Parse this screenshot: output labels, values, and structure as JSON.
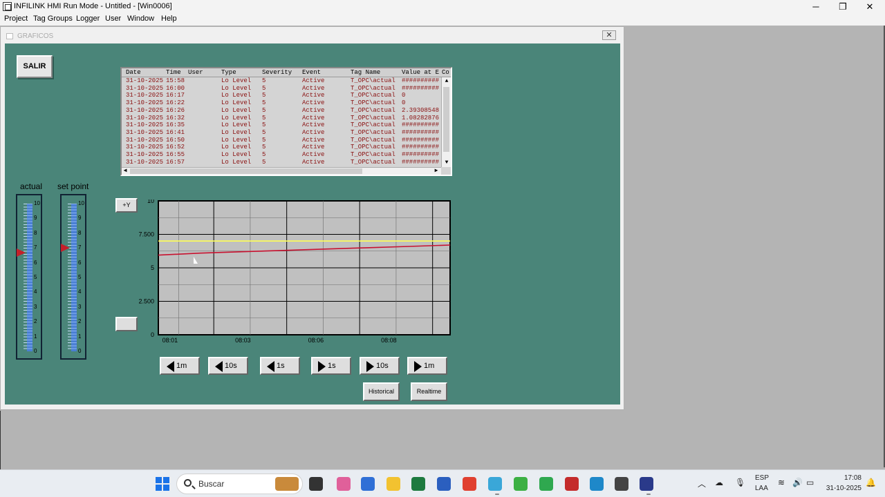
{
  "app": {
    "title": "INFILINK HMI Run Mode - Untitled - [Win0006]",
    "minimize_glyph": "─",
    "restore_glyph": "❐",
    "close_glyph": "✕"
  },
  "menu": [
    "Project",
    "Tag Groups",
    "Logger",
    "User",
    "Window",
    "Help"
  ],
  "child_window": {
    "title": "GRAFICOS",
    "close_glyph": "✕"
  },
  "salir_label": "SALIR",
  "alarm_table": {
    "headers": [
      "Date",
      "Time",
      "User",
      "Type",
      "Severity",
      "Event",
      "Tag Name",
      "Value at E",
      "Co"
    ],
    "rows": [
      [
        "31-10-2025",
        "15:58",
        "",
        "Lo Level",
        "5",
        "Active",
        "T_OPC\\actual",
        "##########"
      ],
      [
        "31-10-2025",
        "16:00",
        "",
        "Lo Level",
        "5",
        "Active",
        "T_OPC\\actual",
        "##########"
      ],
      [
        "31-10-2025",
        "16:17",
        "",
        "Lo Level",
        "5",
        "Active",
        "T_OPC\\actual",
        "0"
      ],
      [
        "31-10-2025",
        "16:22",
        "",
        "Lo Level",
        "5",
        "Active",
        "T_OPC\\actual",
        "0"
      ],
      [
        "31-10-2025",
        "16:26",
        "",
        "Lo Level",
        "5",
        "Active",
        "T_OPC\\actual",
        "2.39308548"
      ],
      [
        "31-10-2025",
        "16:32",
        "",
        "Lo Level",
        "5",
        "Active",
        "T_OPC\\actual",
        "1.08282876"
      ],
      [
        "31-10-2025",
        "16:35",
        "",
        "Lo Level",
        "5",
        "Active",
        "T_OPC\\actual",
        "##########"
      ],
      [
        "31-10-2025",
        "16:41",
        "",
        "Lo Level",
        "5",
        "Active",
        "T_OPC\\actual",
        "##########"
      ],
      [
        "31-10-2025",
        "16:50",
        "",
        "Lo Level",
        "5",
        "Active",
        "T_OPC\\actual",
        "##########"
      ],
      [
        "31-10-2025",
        "16:52",
        "",
        "Lo Level",
        "5",
        "Active",
        "T_OPC\\actual",
        "##########"
      ],
      [
        "31-10-2025",
        "16:55",
        "",
        "Lo Level",
        "5",
        "Active",
        "T_OPC\\actual",
        "##########"
      ],
      [
        "31-10-2025",
        "16:57",
        "",
        "Lo Level",
        "5",
        "Active",
        "T_OPC\\actual",
        "##########"
      ]
    ]
  },
  "gauges": {
    "actual": {
      "label": "actual",
      "value": 6.7,
      "scale": [
        "10",
        "9",
        "8",
        "7",
        "6",
        "5",
        "4",
        "3",
        "2",
        "1",
        "0"
      ]
    },
    "setpoint": {
      "label": "set point",
      "value": 7.0,
      "scale": [
        "10",
        "9",
        "8",
        "7",
        "6",
        "5",
        "4",
        "3",
        "2",
        "1",
        "0"
      ]
    }
  },
  "buttons": {
    "plus_y": "+Y",
    "blank": "",
    "historical": "Historical",
    "realtime": "Realtime",
    "nav": [
      {
        "dir": "left",
        "label": "1m"
      },
      {
        "dir": "left",
        "label": "10s"
      },
      {
        "dir": "left",
        "label": "1s"
      },
      {
        "dir": "right",
        "label": "1s"
      },
      {
        "dir": "right",
        "label": "10s"
      },
      {
        "dir": "right",
        "label": "1m"
      }
    ]
  },
  "chart_data": {
    "type": "line",
    "y_ticks": [
      "10",
      "7.500",
      "5",
      "2.500",
      "0"
    ],
    "ylim": [
      0,
      10
    ],
    "x_ticks": [
      "08:01",
      "08:03",
      "08:06",
      "08:08"
    ],
    "grid": true,
    "series": [
      {
        "color": "#c8102e",
        "values": [
          5.95,
          6.1,
          6.2,
          6.3,
          6.4,
          6.5,
          6.6,
          6.7
        ]
      },
      {
        "color": "#ffff55",
        "values": [
          7.0,
          7.0,
          7.0,
          7.0,
          7.0,
          7.0,
          7.0,
          7.0
        ]
      }
    ],
    "colors": {
      "plot_bg": "#c0c0c0",
      "grid": "#000000",
      "red": "#c8102e",
      "yellow": "#ffff55"
    }
  },
  "taskbar": {
    "search_placeholder": "Buscar",
    "lang_top": "ESP",
    "lang_bottom": "LAA",
    "time": "17:08",
    "date": "31-10-2025",
    "pinned": [
      {
        "name": "widgets-icon",
        "color": "#c98a3b"
      },
      {
        "name": "task-view-icon",
        "color": "#333333"
      },
      {
        "name": "copilot-icon",
        "color": "#e0609a"
      },
      {
        "name": "store-icon",
        "color": "#2f6fd6"
      },
      {
        "name": "folder-icon",
        "color": "#f2c230"
      },
      {
        "name": "excel-icon",
        "color": "#1d7a3f"
      },
      {
        "name": "word-icon",
        "color": "#2b5fbf"
      },
      {
        "name": "chrome-icon",
        "color": "#e04030"
      },
      {
        "name": "snipping-icon",
        "color": "#3aa7d8"
      },
      {
        "name": "refresh-app-icon",
        "color": "#3cb043"
      },
      {
        "name": "ex-app-icon",
        "color": "#2fa84f"
      },
      {
        "name": "shield-app-icon",
        "color": "#c42b2b"
      },
      {
        "name": "vscode-like-icon",
        "color": "#1e88c9"
      },
      {
        "name": "qc-app-icon",
        "color": "#444444"
      },
      {
        "name": "hmi-app-icon",
        "color": "#2a3a8a"
      }
    ]
  }
}
